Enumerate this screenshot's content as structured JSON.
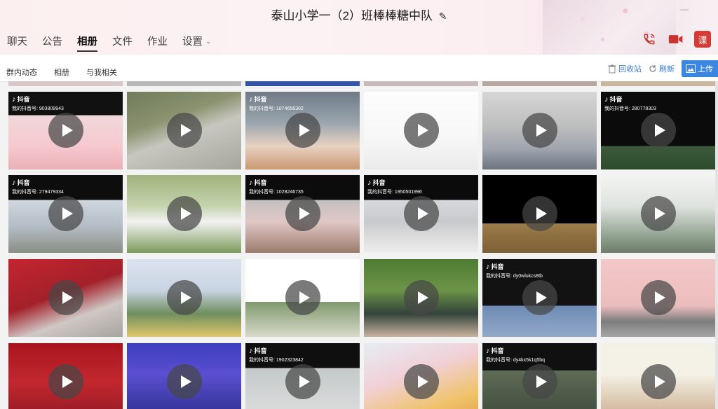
{
  "window": {
    "title": "泰山小学一（2）班棒棒糖中队",
    "edit_icon": "pencil-icon",
    "minimize_label": "—"
  },
  "tabs": [
    {
      "label": "聊天"
    },
    {
      "label": "公告"
    },
    {
      "label": "相册",
      "active": true
    },
    {
      "label": "文件"
    },
    {
      "label": "作业"
    },
    {
      "label": "设置"
    }
  ],
  "call_icons": [
    "phone-icon",
    "video-icon",
    "course-icon"
  ],
  "course_label": "课",
  "subtabs": [
    {
      "label": "群内动态"
    },
    {
      "label": "相册"
    },
    {
      "label": "与我相关"
    }
  ],
  "actions": {
    "recycle": "回收站",
    "refresh": "刷新",
    "upload": "上传"
  },
  "tiles": [
    {
      "brand": "抖音",
      "uid": "我的抖音号: 903809943",
      "bg": "linear-gradient(180deg,#111 0,#111 30%,#f0d7d9 30%,#f6c9cf 70%,#e9b0b6 100%)"
    },
    {
      "brand": "",
      "uid": "",
      "bg": "linear-gradient(160deg,#6f7b5b 0,#8b9370 35%,#c7c7bf 55%,#a5a59a 100%)"
    },
    {
      "brand": "抖音",
      "uid": "我的抖音号: 1074656302",
      "bg": "linear-gradient(180deg,#6e7a86 0,#9aa5ad 40%,#e8d2c2 70%,#c99873 100%)"
    },
    {
      "brand": "",
      "uid": "",
      "bg": "linear-gradient(180deg,#fdfdfd 0,#f7f7f7 60%,#eaeaea 100%)"
    },
    {
      "brand": "",
      "uid": "",
      "bg": "linear-gradient(180deg,#d6d6d6 0,#bdbdbd 45%,#9da3ad 75%,#6d7480 100%)"
    },
    {
      "brand": "抖音",
      "uid": "我的抖音号: 280778303",
      "bg": "linear-gradient(180deg,#0b0b0b 0,#0b0b0b 70%,#3d5a3c 70%,#2c4a2c 100%)"
    },
    {
      "brand": "抖音",
      "uid": "我的抖音号: 279479334",
      "bg": "linear-gradient(180deg,#0d0d0d 0,#0d0d0d 32%,#cfd7df 32%,#b4bec6 65%,#8a8f84 100%)"
    },
    {
      "brand": "",
      "uid": "",
      "bg": "linear-gradient(180deg,#9fb47d 0,#c5d3ad 40%,#f2f2f2 60%,#7c9a5b 100%)"
    },
    {
      "brand": "抖音",
      "uid": "我的抖音号: 1028246735",
      "bg": "linear-gradient(180deg,#0c0c0c 0,#0c0c0c 32%,#c2c0bf 32%,#e0c7c7 60%,#9c7b6b 100%)"
    },
    {
      "brand": "抖音",
      "uid": "我的抖音号: 1950501996",
      "bg": "linear-gradient(180deg,#0b0b0b 0,#0b0b0b 32%,#d5d9dd 32%,#c9cacc 60%,#eee 100%)"
    },
    {
      "brand": "",
      "uid": "",
      "bg": "linear-gradient(180deg,#000 0,#000 62%,#9b7c4a 62%,#7d5f35 100%)"
    },
    {
      "brand": "",
      "uid": "",
      "bg": "linear-gradient(180deg,#f3f4f2 0,#dfe3df 40%,#8fa08d 80%,#6b7d68 100%)"
    },
    {
      "brand": "",
      "uid": "",
      "bg": "linear-gradient(160deg,#c4252f 0,#a3202a 45%,#cfc8c5 70%,#a8a3a0 100%)"
    },
    {
      "brand": "",
      "uid": "",
      "bg": "linear-gradient(180deg,#dbe3ee 0,#c9d4e3 40%,#6f8e5e 70%,#e0c76b 100%)"
    },
    {
      "brand": "",
      "uid": "",
      "bg": "linear-gradient(180deg,#fff 0,#fff 55%,#7e9a6e 55%,#d7d9c8 100%)"
    },
    {
      "brand": "",
      "uid": "",
      "bg": "linear-gradient(180deg,#4e7b33 0,#6c9447 40%,#33433a 70%,#c9b2a0 100%)"
    },
    {
      "brand": "抖音",
      "uid": "我的抖音号: dy0wlukcs8tb",
      "bg": "linear-gradient(180deg,#121212 0,#121212 60%,#6f8bb4 60%,#91a8c7 100%)"
    },
    {
      "brand": "",
      "uid": "",
      "bg": "linear-gradient(180deg,#f2c8c8 0,#edbdbd 60%,#7d7d7d 80%,#a5a5a5 100%)"
    },
    {
      "brand": "",
      "uid": "",
      "bg": "linear-gradient(180deg,#a8151f 0,#c3272e 50%,#8f1a25 100%)"
    },
    {
      "brand": "",
      "uid": "",
      "bg": "linear-gradient(180deg,#3d3fbf 0,#5a4fd0 40%,#2b2d8c 100%)"
    },
    {
      "brand": "抖音",
      "uid": "我的抖音号: 1902323842",
      "bg": "linear-gradient(180deg,#0f0f0f 0,#0f0f0f 32%,#c5c9c9 32%,#dde0df 100%)"
    },
    {
      "brand": "",
      "uid": "",
      "bg": "linear-gradient(160deg,#e7ecf3 0,#f1d0d7 40%,#f0c36a 75%,#e3a24d 100%)"
    },
    {
      "brand": "抖音",
      "uid": "我的抖音号: dy4kx5k1q5bq",
      "bg": "linear-gradient(180deg,#101010 0,#101010 35%,#5e6b56 35%,#3e4a3b 100%)"
    },
    {
      "brand": "",
      "uid": "",
      "bg": "linear-gradient(180deg,#f4f1e6 0,#f4f1e6 40%,#e6d9c7 60%,#c9a98a 100%)"
    }
  ]
}
